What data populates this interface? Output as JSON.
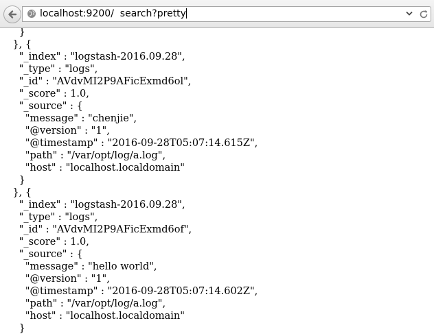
{
  "browser": {
    "url": "localhost:9200/  search?pretty"
  },
  "json_lines": [
    "      }",
    "    }, {",
    "      \"_index\" : \"logstash-2016.09.28\",",
    "      \"_type\" : \"logs\",",
    "      \"_id\" : \"AVdvMI2P9AFicExmd6ol\",",
    "      \"_score\" : 1.0,",
    "      \"_source\" : {",
    "        \"message\" : \"chenjie\",",
    "        \"@version\" : \"1\",",
    "        \"@timestamp\" : \"2016-09-28T05:07:14.615Z\",",
    "        \"path\" : \"/var/opt/log/a.log\",",
    "        \"host\" : \"localhost.localdomain\"",
    "      }",
    "    }, {",
    "      \"_index\" : \"logstash-2016.09.28\",",
    "      \"_type\" : \"logs\",",
    "      \"_id\" : \"AVdvMI2P9AFicExmd6of\",",
    "      \"_score\" : 1.0,",
    "      \"_source\" : {",
    "        \"message\" : \"hello world\",",
    "        \"@version\" : \"1\",",
    "        \"@timestamp\" : \"2016-09-28T05:07:14.602Z\",",
    "        \"path\" : \"/var/opt/log/a.log\",",
    "        \"host\" : \"localhost.localdomain\"",
    "      }"
  ]
}
